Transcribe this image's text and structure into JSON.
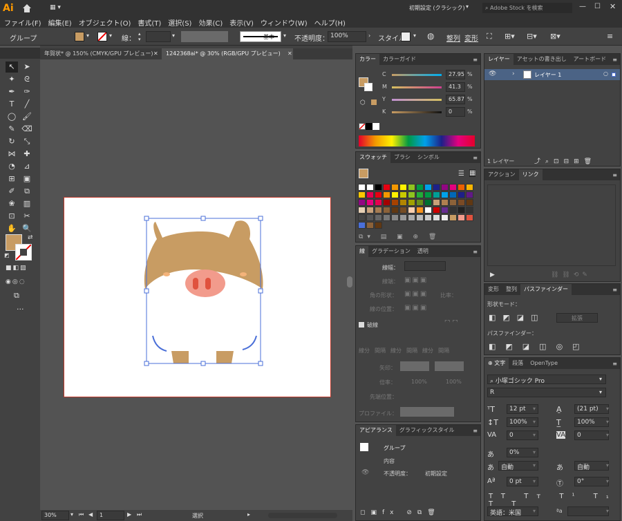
{
  "app": {
    "logo": "Ai",
    "workspace": "初期設定 (クラシック)",
    "search_placeholder": "Adobe Stock を検索"
  },
  "menu": [
    "ファイル(F)",
    "編集(E)",
    "オブジェクト(O)",
    "書式(T)",
    "選択(S)",
    "効果(C)",
    "表示(V)",
    "ウィンドウ(W)",
    "ヘルプ(H)"
  ],
  "control": {
    "selection": "グループ",
    "stroke_label": "線：",
    "stroke_style": "基本",
    "opacity_label": "不透明度：",
    "opacity": "100%",
    "style_label": "スタイル：",
    "align": "整列",
    "transform": "変形"
  },
  "tabs": [
    {
      "label": "年賀状* @ 150% (CMYK/GPU プレビュー)"
    },
    {
      "label": "1242368ai* @ 30% (RGB/GPU プレビュー)"
    }
  ],
  "status": {
    "zoom": "30%",
    "page": "1",
    "tool": "選択"
  },
  "color_panel": {
    "tabs": [
      "カラー",
      "カラーガイド"
    ],
    "channels": [
      {
        "name": "C",
        "value": "27.95",
        "unit": "%"
      },
      {
        "name": "M",
        "value": "41.3",
        "unit": "%"
      },
      {
        "name": "Y",
        "value": "65.87",
        "unit": "%"
      },
      {
        "name": "K",
        "value": "0",
        "unit": "%"
      }
    ]
  },
  "swatch_panel": {
    "tabs": [
      "スウォッチ",
      "ブラシ",
      "シンボル"
    ]
  },
  "stroke_panel": {
    "tabs": [
      "線",
      "グラデーション",
      "透明"
    ],
    "width_label": "線幅：",
    "cap_label": "線端：",
    "corner_label": "角の形状：",
    "limit_label": "比率：",
    "align_label": "線の位置：",
    "dash_label": "破線",
    "dash_cols": [
      "線分",
      "間隔",
      "線分",
      "間隔",
      "線分",
      "間隔"
    ],
    "arrow_label": "矢印：",
    "scale_label": "倍率：",
    "scale1": "100%",
    "scale2": "100%",
    "tip_label": "先端位置：",
    "profile_label": "プロファイル："
  },
  "appearance": {
    "tabs": [
      "アピアランス",
      "グラフィックスタイル"
    ],
    "group": "グループ",
    "content": "内容",
    "opacity_label": "不透明度：",
    "opacity_value": "初期設定"
  },
  "layers": {
    "tabs": [
      "レイヤー",
      "アセットの書き出し",
      "アートボード"
    ],
    "layer_name": "レイヤー 1",
    "count": "1 レイヤー"
  },
  "actions": {
    "tabs": [
      "アクション",
      "リンク"
    ]
  },
  "pathfinder": {
    "tabs": [
      "変形",
      "整列",
      "パスファインダー"
    ],
    "mode_label": "形状モード：",
    "expand": "拡張",
    "pf_label": "パスファインダー："
  },
  "type": {
    "tabs": [
      "文字",
      "段落",
      "OpenType"
    ],
    "font": "小塚ゴシック Pro",
    "style": "R",
    "size": "12 pt",
    "leading": "(21 pt)",
    "vscale": "100%",
    "hscale": "100%",
    "kerning": "0",
    "tracking": "0",
    "tsume": "0%",
    "aki1": "自動",
    "aki2": "自動",
    "baseline": "0 pt",
    "rotation": "0°",
    "language": "英語：米国",
    "aa_label": "ªa"
  },
  "colors": {
    "accent": "#ff9a00",
    "pig_tan": "#c89c63",
    "nose": "#f29b8c",
    "nostril": "#e0523e",
    "select": "#4a6fd8",
    "artboard_border": "#c0392b"
  }
}
